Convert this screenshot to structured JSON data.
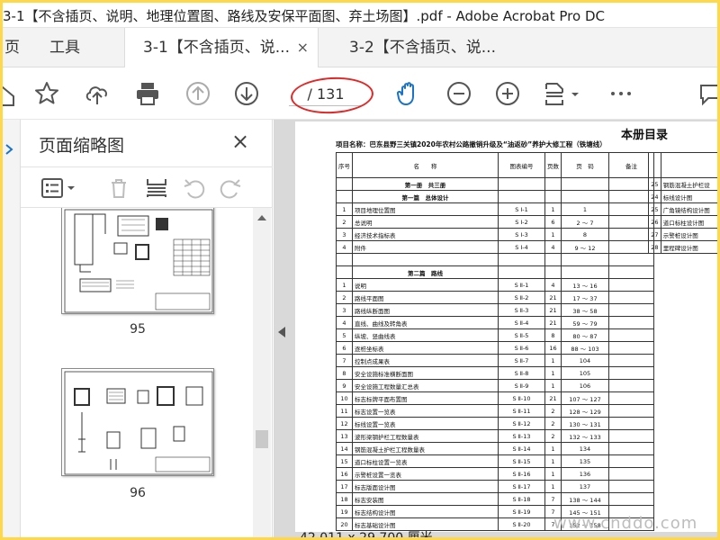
{
  "window": {
    "title": "3-1【不含插页、说明、地理位置图、路线及安保平面图、弃土场图】.pdf - Adobe Acrobat Pro DC"
  },
  "tabs": {
    "home": "页",
    "tools": "工具",
    "doc1": "3-1【不含插页、说...",
    "doc2": "3-2【不含插页、说...",
    "close": "×"
  },
  "toolbar": {
    "page_indicator": "/ 131",
    "highlight_color": "#e32626",
    "icons": [
      "bookmark-star-icon",
      "upload-cloud-icon",
      "print-icon",
      "page-up-icon",
      "page-down-icon",
      "hand-tool-icon",
      "zoom-out-icon",
      "zoom-in-icon",
      "page-layout-icon",
      "more-icon",
      "share-icon"
    ]
  },
  "thumbnails": {
    "title": "页面缩略图",
    "close": "×",
    "pages": [
      {
        "number": "95"
      },
      {
        "number": "96"
      }
    ]
  },
  "document": {
    "heading": "本册目录",
    "project": "项目名称：巴东县野三关镇2020年农村公路撤销升级及“油返砂”养护大修工程（铁塘线）",
    "headers": {
      "no": "序号",
      "name": "名　　称",
      "drawing": "图表编号",
      "pages": "页数",
      "page": "页　码",
      "note": "备注"
    },
    "rows": [
      {
        "section": "第一册　共三册"
      },
      {
        "section": "第一篇　总体设计"
      },
      {
        "no": "1",
        "name": "项目地理位置图",
        "drawing": "S Ⅰ-1",
        "pages": "1",
        "page": "1"
      },
      {
        "no": "2",
        "name": "总说明",
        "drawing": "S Ⅰ-2",
        "pages": "6",
        "page": "2 ～ 7"
      },
      {
        "no": "3",
        "name": "经济技术指标表",
        "drawing": "S Ⅰ-3",
        "pages": "1",
        "page": "8"
      },
      {
        "no": "4",
        "name": "附件",
        "drawing": "S Ⅰ-4",
        "pages": "4",
        "page": "9 ～ 12"
      },
      {
        "section": ""
      },
      {
        "section": "第二篇　路线"
      },
      {
        "no": "1",
        "name": "说明",
        "drawing": "S Ⅱ-1",
        "pages": "4",
        "page": "13 ～ 16"
      },
      {
        "no": "2",
        "name": "路线平面图",
        "drawing": "S Ⅱ-2",
        "pages": "21",
        "page": "17 ～ 37"
      },
      {
        "no": "3",
        "name": "路线纵断面图",
        "drawing": "S Ⅱ-3",
        "pages": "21",
        "page": "38 ～ 58"
      },
      {
        "no": "4",
        "name": "直线、曲线及转角表",
        "drawing": "S Ⅱ-4",
        "pages": "21",
        "page": "59 ～ 79"
      },
      {
        "no": "5",
        "name": "纵坡、竖曲线表",
        "drawing": "S Ⅱ-5",
        "pages": "8",
        "page": "80 ～ 87"
      },
      {
        "no": "6",
        "name": "逐桩坐标表",
        "drawing": "S Ⅱ-6",
        "pages": "16",
        "page": "88 ～ 103"
      },
      {
        "no": "7",
        "name": "控制点成果表",
        "drawing": "S Ⅱ-7",
        "pages": "1",
        "page": "104"
      },
      {
        "no": "8",
        "name": "安全设施标准横断面图",
        "drawing": "S Ⅱ-8",
        "pages": "1",
        "page": "105"
      },
      {
        "no": "9",
        "name": "安全设施工程数量汇总表",
        "drawing": "S Ⅱ-9",
        "pages": "1",
        "page": "106"
      },
      {
        "no": "10",
        "name": "标志标牌平面布置图",
        "drawing": "S Ⅱ-10",
        "pages": "21",
        "page": "107 ～ 127"
      },
      {
        "no": "11",
        "name": "标志设置一览表",
        "drawing": "S Ⅱ-11",
        "pages": "2",
        "page": "128 ～ 129"
      },
      {
        "no": "12",
        "name": "标线设置一览表",
        "drawing": "S Ⅱ-12",
        "pages": "2",
        "page": "130 ～ 131"
      },
      {
        "no": "13",
        "name": "波形梁钢护栏工程数量表",
        "drawing": "S Ⅱ-13",
        "pages": "2",
        "page": "132 ～ 133"
      },
      {
        "no": "14",
        "name": "钢筋混凝土护栏工程数量表",
        "drawing": "S Ⅱ-14",
        "pages": "1",
        "page": "134"
      },
      {
        "no": "15",
        "name": "道口标柱设置一览表",
        "drawing": "S Ⅱ-15",
        "pages": "1",
        "page": "135"
      },
      {
        "no": "16",
        "name": "示警桩设置一览表",
        "drawing": "S Ⅱ-16",
        "pages": "1",
        "page": "136"
      },
      {
        "no": "17",
        "name": "标志版面设计图",
        "drawing": "S Ⅱ-17",
        "pages": "1",
        "page": "137"
      },
      {
        "no": "18",
        "name": "标志安装图",
        "drawing": "S Ⅱ-18",
        "pages": "7",
        "page": "138 ～ 144"
      },
      {
        "no": "19",
        "name": "标志结构设计图",
        "drawing": "S Ⅱ-19",
        "pages": "7",
        "page": "145 ～ 151"
      },
      {
        "no": "20",
        "name": "标志基础设计图",
        "drawing": "S Ⅱ-20",
        "pages": "7",
        "page": "152 ～ 158"
      }
    ],
    "right_rows": [
      {
        "no": "25",
        "name": "钢筋混凝土护栏设"
      },
      {
        "no": "24",
        "name": "标线设计图"
      },
      {
        "no": "25",
        "name": "广角镜结构设计图"
      },
      {
        "no": "26",
        "name": "道口标柱设计图"
      },
      {
        "no": "27",
        "name": "示警桩设计图"
      },
      {
        "no": "28",
        "name": "里程碑设计图"
      }
    ]
  },
  "status": {
    "dimensions": "42.011 x 29.700 厘米"
  },
  "watermark": "www.cnddo.com"
}
